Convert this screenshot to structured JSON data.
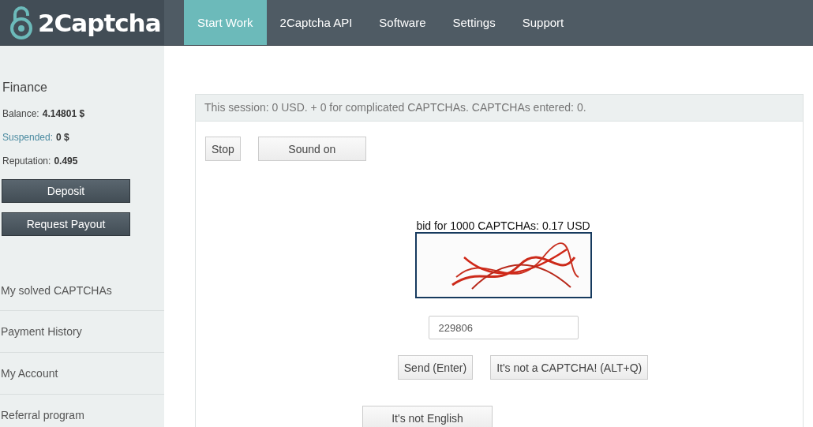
{
  "logo": {
    "text": "2Captcha"
  },
  "nav": [
    {
      "label": "Start Work",
      "selected": true
    },
    {
      "label": "2Captcha API",
      "selected": false
    },
    {
      "label": "Software",
      "selected": false
    },
    {
      "label": "Settings",
      "selected": false
    },
    {
      "label": "Support",
      "selected": false
    }
  ],
  "sidebar": {
    "finance_title": "Finance",
    "stats": [
      {
        "label": "Balance:",
        "value": "4.14801 $",
        "kind": "plain"
      },
      {
        "label": "Suspended:",
        "value": "0 $",
        "kind": "link"
      },
      {
        "label": "Reputation:",
        "value": "0.495",
        "kind": "plain"
      }
    ],
    "buttons": [
      "Deposit",
      "Request Payout"
    ],
    "items": [
      "My solved CAPTCHAs",
      "Payment History",
      "My Account",
      "Referral program"
    ]
  },
  "session": {
    "summary": "This session: 0 USD. + 0 for complicated CAPTCHAs. CAPTCHAs entered: 0.",
    "controls": [
      "Stop",
      "Sound on"
    ],
    "bid": "bid for 1000 CAPTCHAs: 0.17 USD",
    "captcha": {
      "kind": "picture"
    },
    "answer": {
      "value": "229806"
    },
    "actions": [
      "Send (Enter)",
      "It's not a CAPTCHA! (ALT+Q)"
    ],
    "language_button": "It's not English"
  }
}
